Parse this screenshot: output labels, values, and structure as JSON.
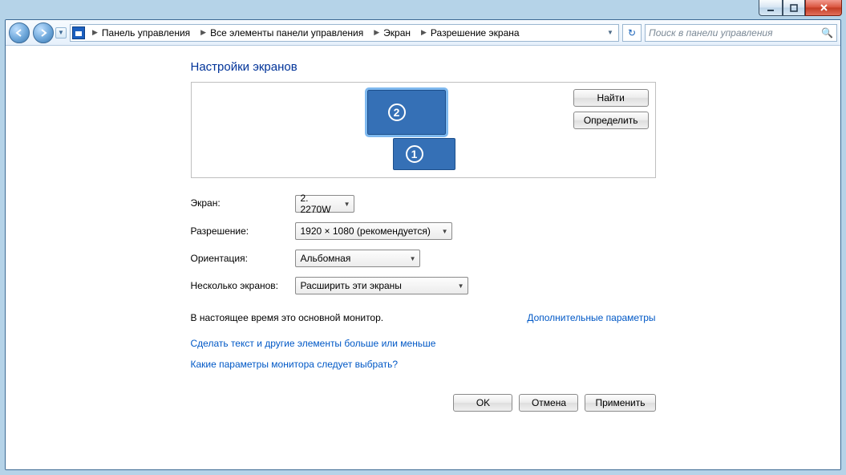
{
  "titlebar": {
    "minimize_tip": "Свернуть",
    "maximize_tip": "Развернуть",
    "close_tip": "Закрыть"
  },
  "toolbar": {
    "breadcrumbs": [
      "Панель управления",
      "Все элементы панели управления",
      "Экран",
      "Разрешение экрана"
    ],
    "search_placeholder": "Поиск в панели управления"
  },
  "page": {
    "title": "Настройки экранов",
    "find_btn": "Найти",
    "identify_btn": "Определить",
    "monitor_labels": {
      "primary": "1",
      "secondary": "2"
    }
  },
  "form": {
    "screen_label": "Экран:",
    "screen_value": "2. 2270W",
    "resolution_label": "Разрешение:",
    "resolution_value": "1920 × 1080 (рекомендуется)",
    "orientation_label": "Ориентация:",
    "orientation_value": "Альбомная",
    "multiple_label": "Несколько экранов:",
    "multiple_value": "Расширить эти экраны"
  },
  "notes": {
    "primary_note": "В настоящее время это основной монитор.",
    "advanced_link": "Дополнительные параметры",
    "text_size_link": "Сделать текст и другие элементы больше или меньше",
    "which_link": "Какие параметры монитора следует выбрать?"
  },
  "footer": {
    "ok": "OK",
    "cancel": "Отмена",
    "apply": "Применить"
  }
}
